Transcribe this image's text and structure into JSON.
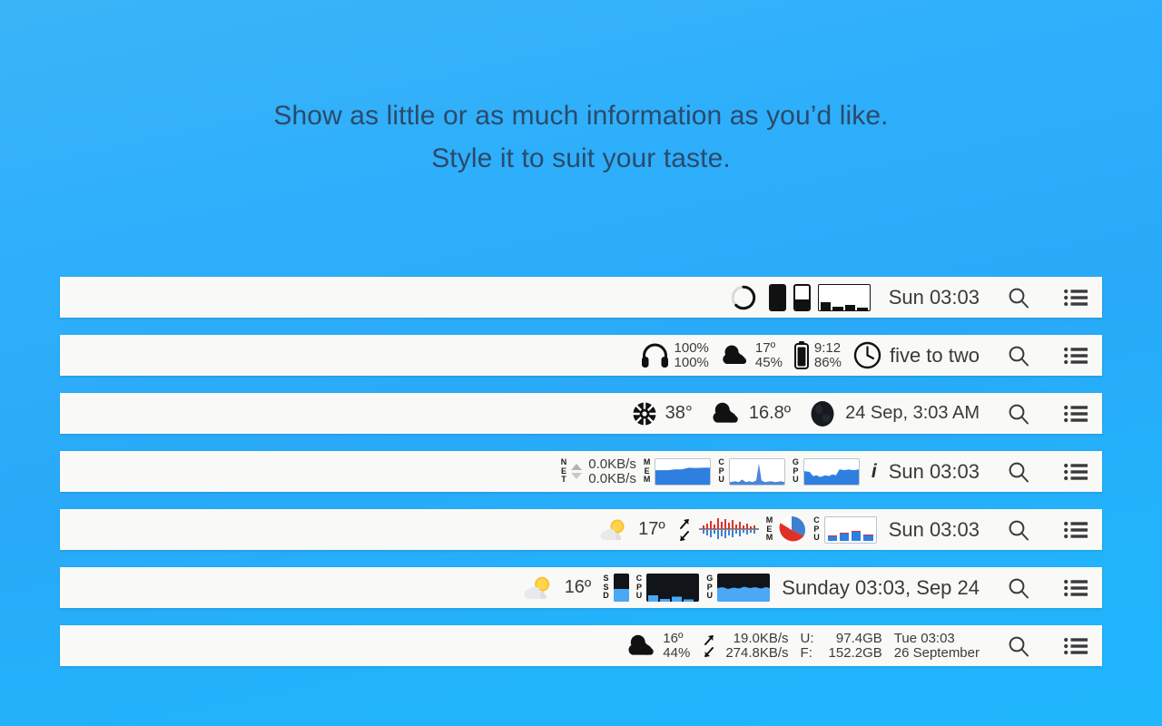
{
  "headline": {
    "line1": "Show as little or as much information as you’d like.",
    "line2": "Style it to suit your taste."
  },
  "colors": {
    "background_top": "#3bb4f7",
    "background_bottom": "#1fb6fc",
    "bar_background": "#f9f9f7",
    "text": "#3a3a3a",
    "headline_text": "#2b4a6b",
    "accent_blue": "#2f7fe0",
    "accent_red": "#e03127",
    "dark_panel": "#111418"
  },
  "system_icons": {
    "search": "search-icon",
    "menu": "list-menu-icon"
  },
  "bars": [
    {
      "id": "bar-1",
      "items": [
        {
          "type": "donut",
          "name": "pie-gauge-widget",
          "value": 75
        },
        {
          "type": "vbar",
          "name": "vertical-bar-widget",
          "value": 100
        },
        {
          "type": "vbar",
          "name": "vertical-bar-widget-2",
          "value": 40
        },
        {
          "type": "barchart",
          "name": "bar-chart-widget",
          "values": [
            32,
            14,
            20,
            10
          ]
        },
        {
          "type": "clock",
          "name": "clock-text",
          "text": "Sun 03:03"
        }
      ]
    },
    {
      "id": "bar-2",
      "items": [
        {
          "type": "icon-stack",
          "name": "headphones-widget",
          "icon": "headphones-icon",
          "line1": "100%",
          "line2": "100%"
        },
        {
          "type": "icon-stack",
          "name": "weather-widget",
          "icon": "cloud-icon",
          "line1": "17º",
          "line2": "45%"
        },
        {
          "type": "icon-stack",
          "name": "battery-widget",
          "icon": "battery-icon",
          "line1": "9:12",
          "line2": "86%"
        },
        {
          "type": "icon-clock",
          "name": "word-clock-widget",
          "icon": "analog-clock-icon",
          "text": "five to two"
        }
      ]
    },
    {
      "id": "bar-3",
      "items": [
        {
          "type": "icon-text",
          "name": "fan-temp-widget",
          "icon": "fan-icon",
          "text": "38°"
        },
        {
          "type": "icon-text",
          "name": "weather-widget",
          "icon": "cloud-icon",
          "text": "16.8º"
        },
        {
          "type": "icon-clock",
          "name": "moon-date-widget",
          "icon": "moon-icon",
          "text": "24 Sep, 3:03 AM"
        }
      ]
    },
    {
      "id": "bar-4",
      "items": [
        {
          "type": "net",
          "name": "network-widget",
          "label": "NET",
          "line1": "0.0KB/s",
          "line2": "0.0KB/s"
        },
        {
          "type": "graph",
          "name": "memory-graph-widget",
          "label": "MEM",
          "graph": "mem"
        },
        {
          "type": "graph",
          "name": "cpu-graph-widget",
          "label": "CPU",
          "graph": "cpu"
        },
        {
          "type": "graph",
          "name": "gpu-graph-widget",
          "label": "GPU",
          "graph": "gpu"
        },
        {
          "type": "info-clock",
          "name": "info-clock-widget",
          "icon": "info-icon",
          "text": "Sun 03:03"
        }
      ]
    },
    {
      "id": "bar-5",
      "items": [
        {
          "type": "emoji-text",
          "name": "weather-widget",
          "icon": "sun-behind-cloud-icon",
          "text": "17º"
        },
        {
          "type": "netarrows",
          "name": "network-arrows-icon"
        },
        {
          "type": "waveform",
          "name": "network-waveform-widget"
        },
        {
          "type": "pie",
          "name": "memory-pie-widget",
          "label": "MEM"
        },
        {
          "type": "bluebars",
          "name": "cpu-bars-widget",
          "label": "CPU",
          "values": [
            22,
            34,
            40,
            26
          ]
        },
        {
          "type": "clock",
          "name": "clock-text",
          "text": "Sun 03:03"
        }
      ]
    },
    {
      "id": "bar-6",
      "items": [
        {
          "type": "emoji-text",
          "name": "weather-widget",
          "icon": "sun-behind-cloud-icon",
          "text": "16º"
        },
        {
          "type": "darkbar",
          "name": "ssd-widget",
          "label": "SSD",
          "value": 45
        },
        {
          "type": "darkpanel",
          "name": "cpu-dark-widget",
          "label": "CPU",
          "graph": "cpubars"
        },
        {
          "type": "darkpanel",
          "name": "gpu-dark-widget",
          "label": "GPU",
          "graph": "gpuarea"
        },
        {
          "type": "clock",
          "name": "clock-text",
          "text": "Sunday 03:03, Sep 24"
        }
      ]
    },
    {
      "id": "bar-7",
      "items": [
        {
          "type": "icon-stack",
          "name": "weather-widget",
          "icon": "cloud-icon",
          "line1": "16º",
          "line2": "44%"
        },
        {
          "type": "arrows-stack",
          "name": "network-transfer-widget",
          "line1": "19.0KB/s",
          "line2": "274.8KB/s"
        },
        {
          "type": "disk",
          "name": "disk-usage-widget",
          "key1": "U:",
          "val1": "97.4GB",
          "key2": "F:",
          "val2": "152.2GB"
        },
        {
          "type": "date-stack",
          "name": "date-widget",
          "line1": "Tue 03:03",
          "line2": "26 September"
        }
      ]
    }
  ]
}
